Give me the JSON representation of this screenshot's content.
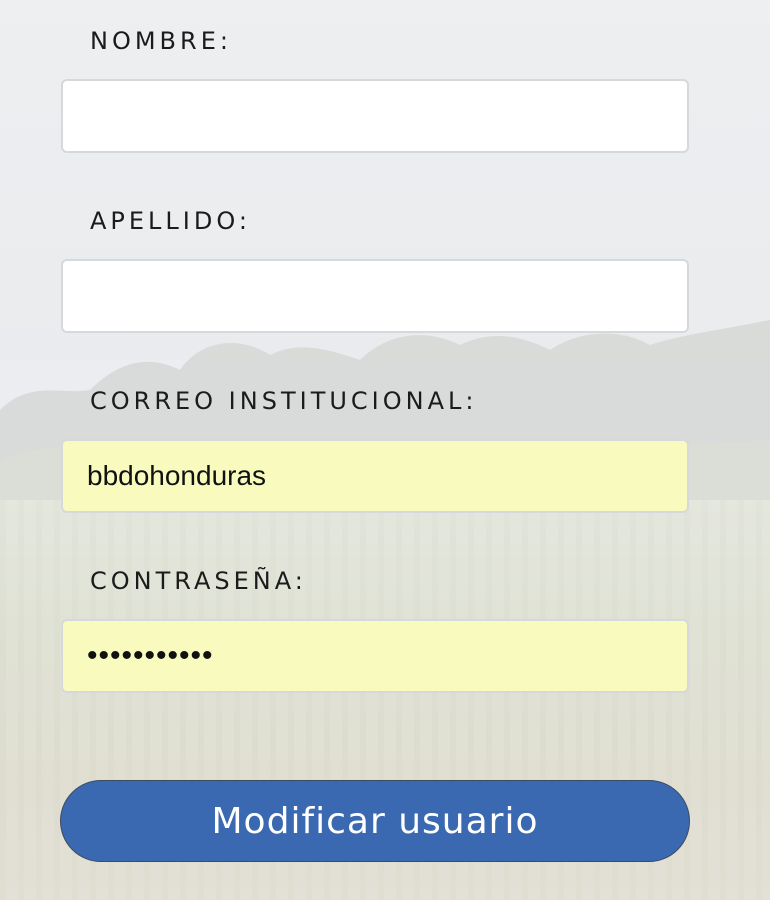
{
  "form": {
    "nombre": {
      "label": "NOMBRE:",
      "value": "",
      "placeholder": ""
    },
    "apellido": {
      "label": "APELLIDO:",
      "value": "",
      "placeholder": ""
    },
    "correo": {
      "label": "CORREO INSTITUCIONAL:",
      "value": "bbdohonduras",
      "placeholder": ""
    },
    "contrasena": {
      "label": "CONTRASEÑA:",
      "value": "•••••••••••",
      "placeholder": ""
    },
    "submit_label": "Modificar usuario"
  },
  "colors": {
    "autofill": "#f8fbbd",
    "button": "#3a69b1",
    "input_border": "#d5d9dc"
  }
}
